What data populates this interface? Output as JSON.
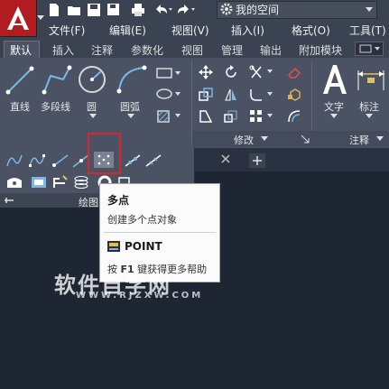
{
  "app": {
    "logo_letter": "A",
    "brand_color": "#b01c20"
  },
  "workspace": {
    "value": "我的空间"
  },
  "menubar": {
    "items": [
      "文件(F)",
      "编辑(E)",
      "视图(V)",
      "插入(I)",
      "格式(O)",
      "工具(T)"
    ]
  },
  "ribbon": {
    "tabs": [
      "默认",
      "插入",
      "注释",
      "参数化",
      "视图",
      "管理",
      "输出",
      "附加模块"
    ],
    "active_tab": "默认",
    "draw_tools": [
      "直线",
      "多段线",
      "圆",
      "圆弧"
    ],
    "annotation_tools": [
      "文字",
      "标注"
    ],
    "panels": {
      "modify": "修改",
      "annotation": "注释",
      "draw": "绘图"
    }
  },
  "tooltip": {
    "title": "多点",
    "description": "创建多个点对象",
    "command": "POINT",
    "help_prefix": "按 ",
    "help_key": "F1",
    "help_suffix": " 键获得更多帮助"
  },
  "watermark": {
    "text": "软件自学网",
    "url": "WWW.RJZXW.COM"
  },
  "colors": {
    "ribbon_bg": "#4a5263",
    "canvas_bg": "#1f2633",
    "highlight": "#d9262a"
  }
}
